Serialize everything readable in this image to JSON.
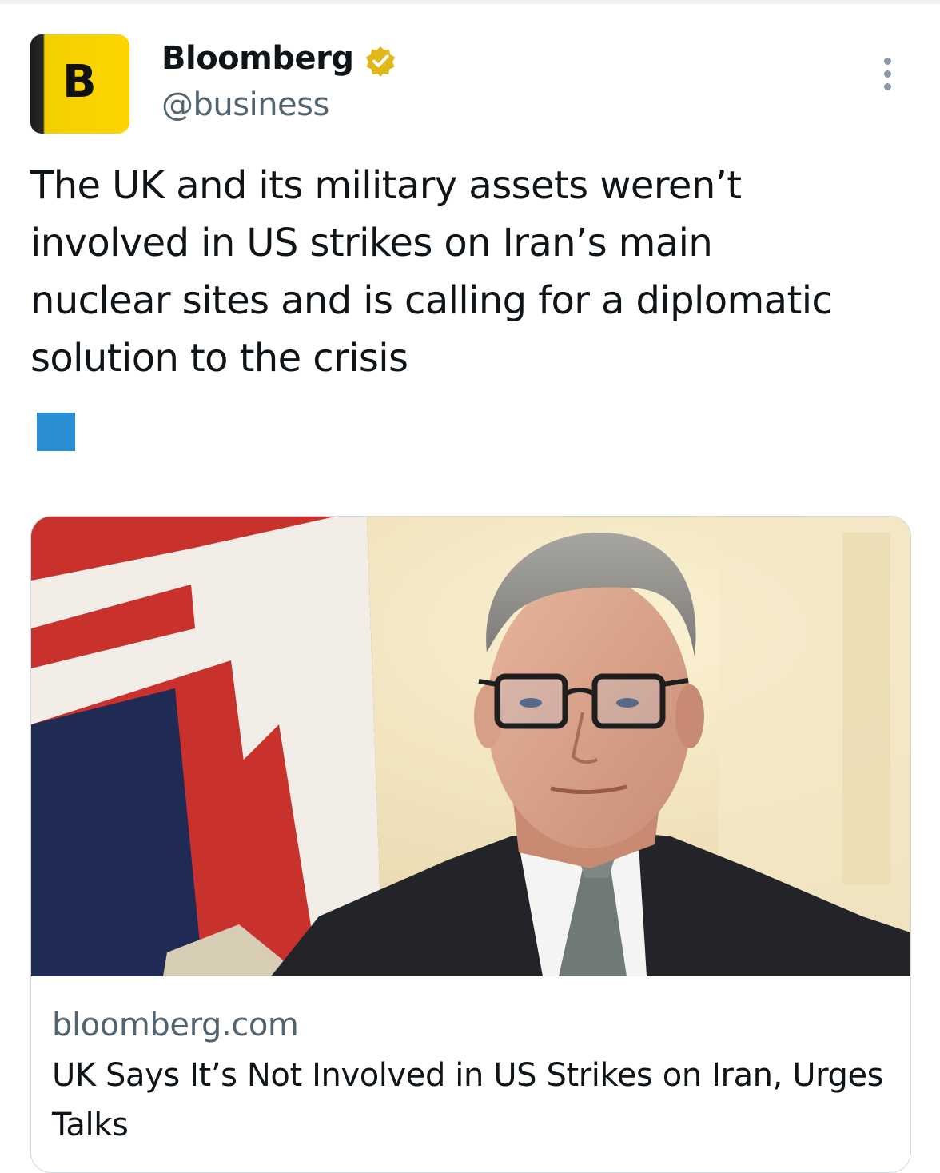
{
  "tweet": {
    "author": {
      "avatar_letter": "B",
      "name": "Bloomberg",
      "handle": "@business",
      "verified": true
    },
    "text_lines": [
      "The UK and its military assets weren’t",
      "involved in US strikes on Iran’s main",
      "nuclear sites and is calling for a diplomatic",
      "solution to the crisis"
    ],
    "emoji": "blue-square-emoji"
  },
  "card": {
    "domain": "bloomberg.com",
    "title": "UK Says It’s Not Involved in US Strikes on Iran, Urges Talks"
  },
  "colors": {
    "brand_yellow": "#ffd500",
    "verified_gold": "#e2b719",
    "secondary_text": "#536471",
    "emoji_blue": "#2b8fd6",
    "card_border": "#cfd9de"
  }
}
